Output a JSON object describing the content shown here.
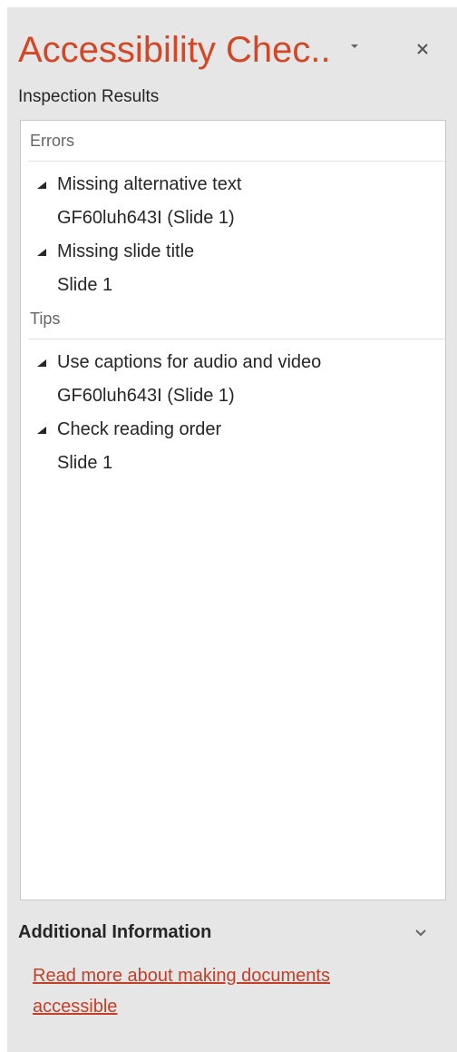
{
  "pane": {
    "title": "Accessibility Chec..",
    "subtitle": "Inspection Results",
    "title_color": "#d24726",
    "dropdown_icon": "caret-down-icon",
    "close_icon": "close-icon"
  },
  "results": {
    "errors_header": "Errors",
    "errors": [
      {
        "label": "Missing alternative text",
        "detail": "GF60luh643I  (Slide 1)"
      },
      {
        "label": "Missing slide title",
        "detail": "Slide 1"
      }
    ],
    "tips_header": "Tips",
    "tips": [
      {
        "label": "Use captions for audio and video",
        "detail": "GF60luh643I  (Slide 1)"
      },
      {
        "label": "Check reading order",
        "detail": "Slide 1"
      }
    ],
    "expand_icon": "triangle-expanded-icon"
  },
  "additional_info": {
    "title": "Additional Information",
    "chevron_icon": "chevron-down-icon",
    "link_text": "Read more about making documents accessible",
    "link_color": "#c0412a"
  }
}
